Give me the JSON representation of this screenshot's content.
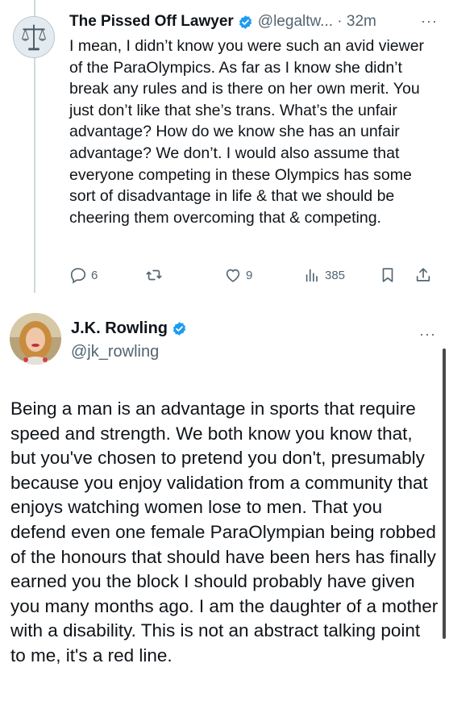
{
  "reply_tweet": {
    "author_name": "The Pissed Off Lawyer",
    "handle_time": "@legaltw... · 32m",
    "more_label": "···",
    "text": "I mean, I didn’t know you were such an avid viewer of the ParaOlympics. As far as I know she didn’t break any rules and is there on her own merit. You just don’t like that she’s trans. What’s the unfair advantage? How do we know she has an unfair advantage? We don’t. I would also assume that everyone competing in these Olympics has some sort of disadvantage in life & that we should be cheering them overcoming that & competing.",
    "actions": {
      "replies": "6",
      "likes": "9",
      "views": "385"
    },
    "icons": [
      "scales-of-justice-avatar",
      "verified-badge-icon",
      "reply-icon",
      "retweet-icon",
      "like-icon",
      "views-icon",
      "bookmark-icon",
      "share-icon"
    ]
  },
  "main_tweet": {
    "author_name": "J.K. Rowling",
    "handle": "@jk_rowling",
    "more_label": "···",
    "text": "Being a man is an advantage in sports that require speed and strength. We both know you know that, but you've chosen to pretend you don't, presumably because you enjoy validation from a community that enjoys watching women lose to men. That you defend even one female ParaOlympian being robbed of the honours that should have been hers has finally earned you the block I should probably have given you many months ago. I am the daughter of a mother with a disability. This is not an abstract talking point to me, it's a red line."
  },
  "colors": {
    "text": "#0f1419",
    "secondary": "#536471",
    "verified": "#1d9bf0",
    "thread_line": "#cfd9de"
  }
}
